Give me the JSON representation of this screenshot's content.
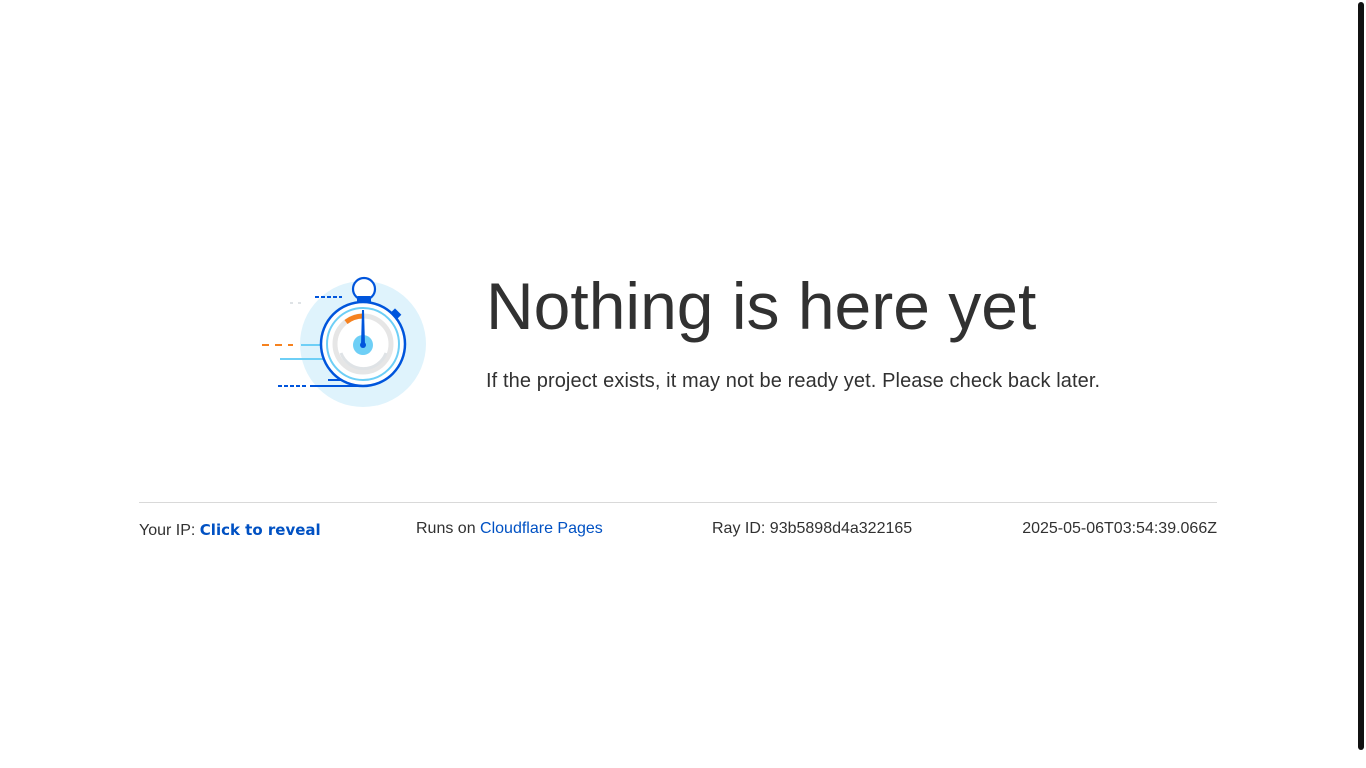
{
  "main": {
    "title": "Nothing is here yet",
    "message": "If the project exists, it may not be ready yet. Please check back later."
  },
  "footer": {
    "ip_label": "Your IP:",
    "ip_reveal": "Click to reveal",
    "runs_on_label": "Runs on",
    "runs_on_link": "Cloudflare Pages",
    "ray_label": "Ray ID:",
    "ray_id": "93b5898d4a322165",
    "timestamp": "2025-05-06T03:54:39.066Z"
  },
  "icons": {
    "illustration": "stopwatch-icon"
  },
  "colors": {
    "text": "#313131",
    "link": "#0051c3",
    "accent_blue": "#0055dc",
    "light_blue": "#dff3fc",
    "orange": "#f6821f"
  }
}
